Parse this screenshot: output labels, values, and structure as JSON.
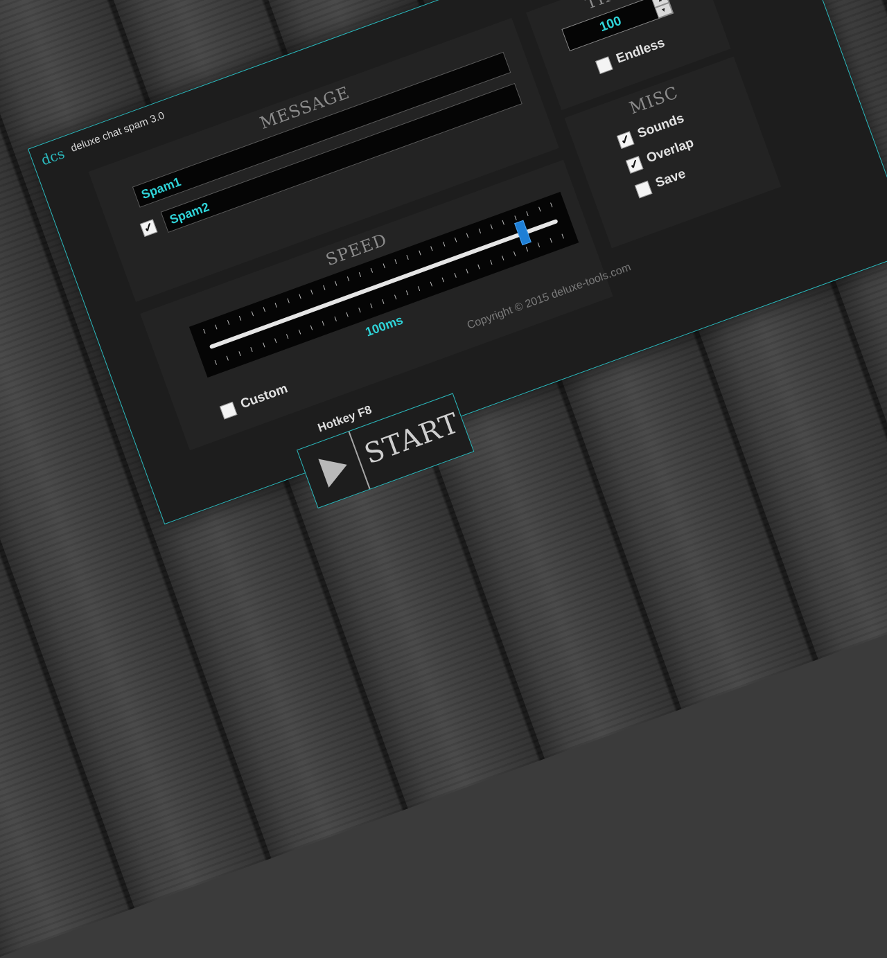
{
  "window": {
    "title": "deluxe chat spam 3.0",
    "logo_text": "dcs"
  },
  "message": {
    "title": "MESSAGE",
    "line1": "Spam1",
    "line2": "Spam2",
    "line2_enabled": true
  },
  "speed": {
    "title": "SPEED",
    "value_label": "100ms",
    "slider_level": 0.9,
    "custom_label": "Custom",
    "custom_checked": false
  },
  "times": {
    "title": "TIMES",
    "value": "100",
    "endless_label": "Endless",
    "endless_checked": false
  },
  "misc": {
    "title": "MISC",
    "options": [
      {
        "label": "Sounds",
        "checked": true
      },
      {
        "label": "Overlap",
        "checked": true
      },
      {
        "label": "Save",
        "checked": false
      }
    ]
  },
  "footer": {
    "copyright": "Copyright © 2015 deluxe-tools.com"
  },
  "start": {
    "hotkey": "Hotkey F8",
    "label": "START"
  },
  "colors": {
    "accent": "#2bb9bd",
    "value_text": "#2fd4d9",
    "slider_thumb": "#1e7fd6"
  },
  "icons": {
    "play": "play-icon",
    "check": "checkmark-icon"
  }
}
